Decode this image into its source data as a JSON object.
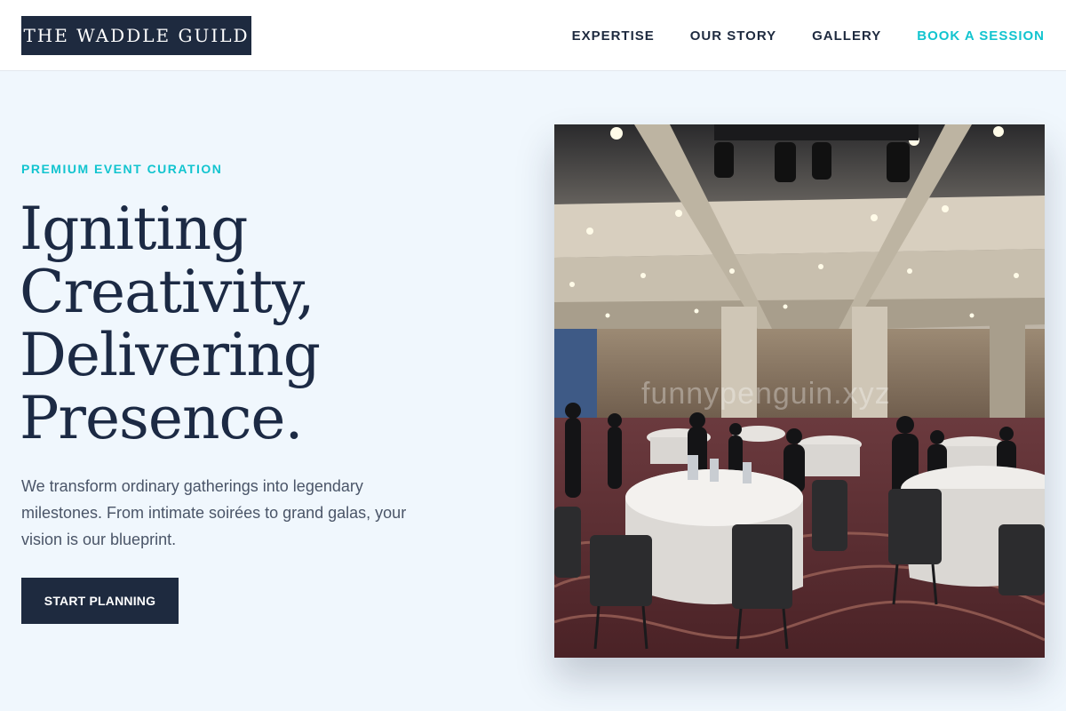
{
  "brand": {
    "name": "THE WADDLE GUILD"
  },
  "nav": {
    "items": [
      {
        "label": "EXPERTISE"
      },
      {
        "label": "OUR STORY"
      },
      {
        "label": "GALLERY"
      },
      {
        "label": "BOOK A SESSION"
      }
    ]
  },
  "hero": {
    "eyebrow": "PREMIUM EVENT CURATION",
    "headline_lines": [
      "Igniting",
      "Creativity,",
      "Delivering",
      "Presence."
    ],
    "description": "We transform ordinary gatherings into legendary milestones. From intimate soirées to grand galas, your vision is our blueprint.",
    "cta_label": "START PLANNING",
    "image_watermark": "funnypenguin.xyz"
  },
  "colors": {
    "accent": "#12c4cf",
    "navy": "#1e2a3f",
    "background": "#f0f7fd"
  }
}
